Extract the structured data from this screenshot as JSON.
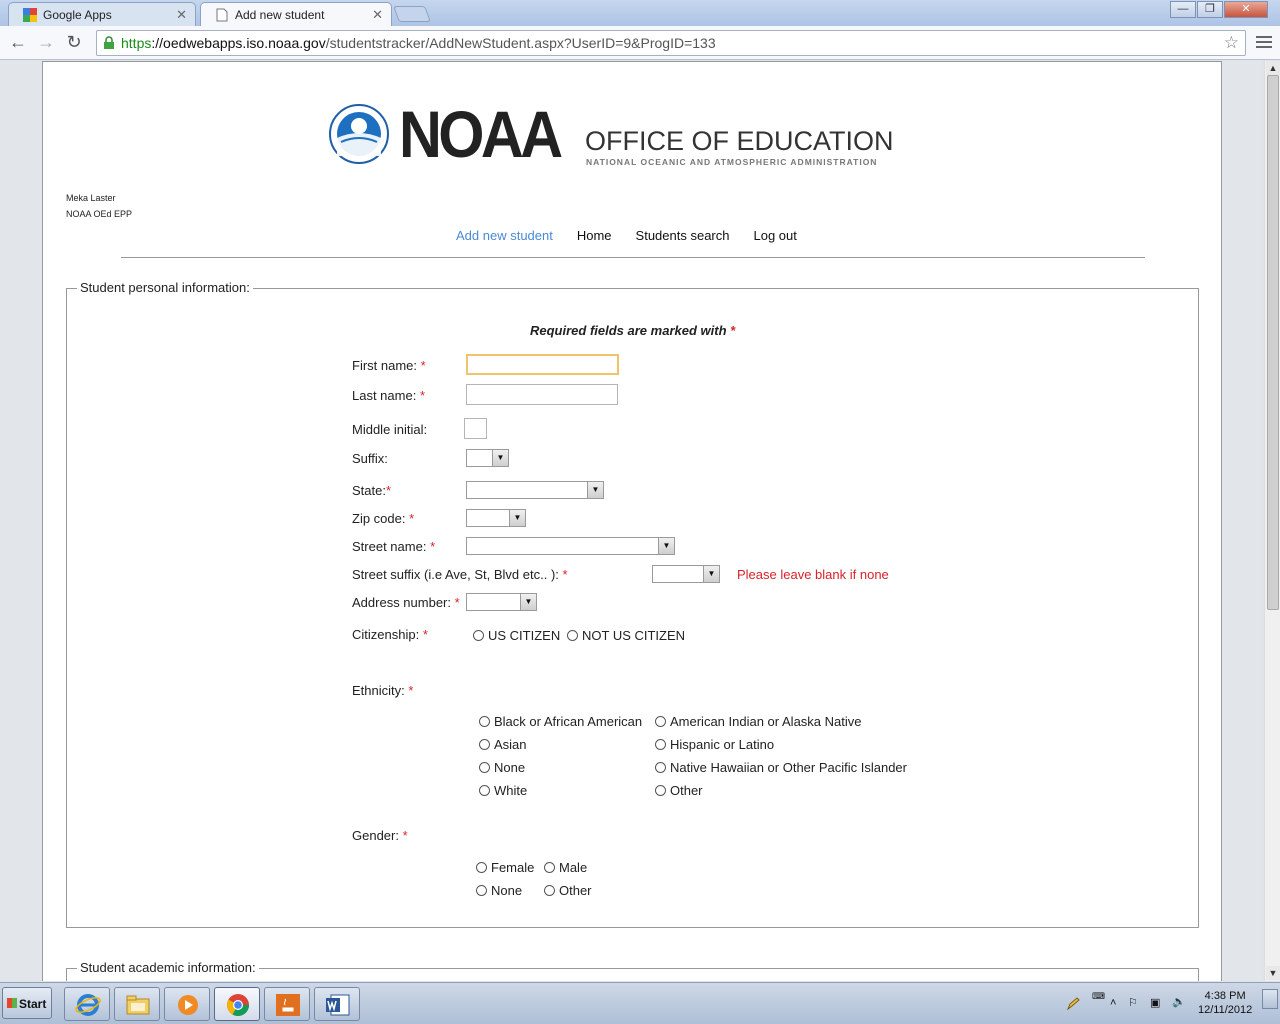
{
  "browser": {
    "tabs": [
      {
        "label": "Google Apps",
        "active": false
      },
      {
        "label": "Add new student",
        "active": true
      }
    ],
    "url_scheme": "https",
    "url_host": "://oedwebapps.iso.noaa.gov",
    "url_path": "/studentstracker/AddNewStudent.aspx?UserID=9&ProgID=133",
    "window_buttons": {
      "minimize": "—",
      "maximize": "❐",
      "close": "✕"
    }
  },
  "header": {
    "logo_word": "NOAA",
    "logo_office": "OFFICE OF EDUCATION",
    "logo_sub": "NATIONAL OCEANIC AND ATMOSPHERIC ADMINISTRATION",
    "user_name": "Meka Laster",
    "user_org": "NOAA OEd EPP"
  },
  "nav": {
    "links": [
      "Add new student",
      "Home",
      "Students search",
      "Log out"
    ]
  },
  "personal": {
    "legend": "Student personal information:",
    "required_note": "Required fields are marked with",
    "required_mark": "*",
    "first_name_label": "First name:",
    "last_name_label": "Last name:",
    "middle_initial_label": "Middle initial:",
    "suffix_label": "Suffix:",
    "state_label": "State:",
    "zip_label": "Zip code:",
    "street_name_label": "Street name:",
    "street_suffix_label": "Street suffix (i.e Ave, St, Blvd etc.. ):",
    "street_suffix_hint": "Please leave blank if none",
    "address_number_label": "Address number:",
    "citizenship_label": "Citizenship:",
    "citizenship_options": [
      "US CITIZEN",
      "NOT US CITIZEN"
    ],
    "ethnicity_label": "Ethnicity:",
    "ethnicity_options": [
      "Black or African American",
      "American Indian or Alaska Native",
      "Asian",
      "Hispanic or Latino",
      "None",
      "Native Hawaiian or Other Pacific Islander",
      "White",
      "Other"
    ],
    "gender_label": "Gender:",
    "gender_options": [
      "Female",
      "Male",
      "None",
      "Other"
    ]
  },
  "academic": {
    "legend": "Student academic information:"
  },
  "taskbar": {
    "start_label": "Start",
    "time": "4:38 PM",
    "date": "12/11/2012"
  }
}
